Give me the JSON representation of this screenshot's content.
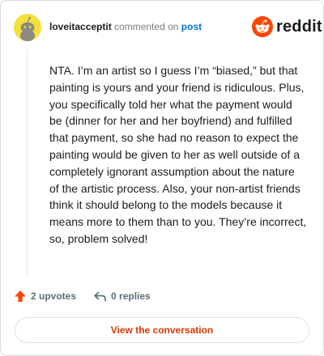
{
  "header": {
    "username": "loveitacceptit",
    "action_text": "commented on",
    "post_link": "post"
  },
  "logo": {
    "wordmark": "reddit",
    "icon": "reddit-snoo-icon",
    "brand_color": "#ff4500"
  },
  "avatar": {
    "icon": "snoo-avatar-icon",
    "color": "#f3e03b"
  },
  "comment": {
    "text": "NTA. I’m an artist so I guess I’m “biased,” but that painting is yours and your friend is ridiculous. Plus, you specifically told her what the payment would be (dinner for her and her boyfriend) and fulfilled that payment, so she had no reason to expect the painting would be given to her as well outside of a completely ignorant assumption about the nature of the artistic process. Also, your non-artist friends think it should belong to the models because it means more to them than to you. They’re incorrect, so, problem solved!"
  },
  "actions": {
    "upvotes": "2 upvotes",
    "upvote_icon": "upvote-arrow-icon",
    "upvote_color": "#ff4500",
    "replies": "0 replies",
    "reply_icon": "reply-arrow-icon"
  },
  "cta": {
    "label": "View the conversation",
    "color": "#d93a00"
  }
}
